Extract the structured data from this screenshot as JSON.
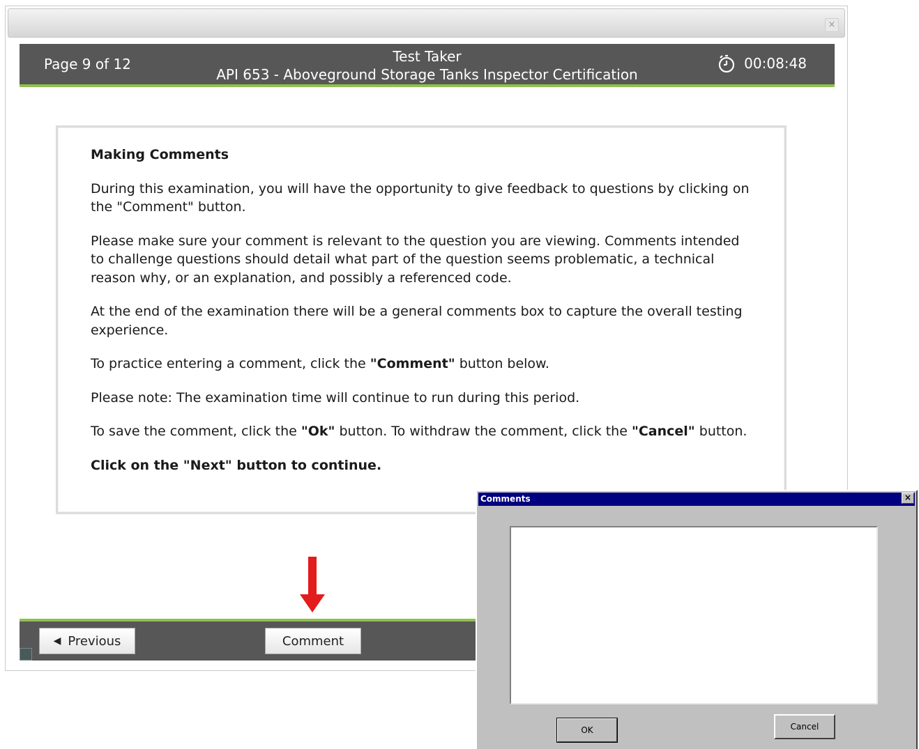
{
  "window": {
    "close_label": "×"
  },
  "header": {
    "page_indicator": "Page 9 of 12",
    "test_taker": "Test Taker",
    "exam_title": "API 653 - Aboveground Storage Tanks Inspector Certification",
    "timer": "00:08:48",
    "timer_icon": "stopwatch-icon",
    "accent_color": "#8fc050",
    "bar_color": "#575757"
  },
  "content": {
    "heading": "Making Comments",
    "p1": "During this examination, you will have the opportunity to give feedback to questions by clicking on the \"Comment\" button.",
    "p2": "Please make sure your comment is relevant to the question you are viewing. Comments intended to challenge questions should detail what part of the question seems problematic, a technical reason why, or an explanation, and possibly a referenced code.",
    "p3": "At the end of the examination there will be a general comments box to capture the overall testing experience.",
    "p4_before": "To practice entering a comment, click the ",
    "p4_bold": "\"Comment\"",
    "p4_after": " button below.",
    "p5": "Please note: The examination time will continue to run during this period.",
    "p6_a": "To save the comment, click the ",
    "p6_b": "\"Ok\"",
    "p6_c": " button. To withdraw the comment, click the ",
    "p6_d": "\"Cancel\"",
    "p6_e": " button.",
    "p7": "Click on the \"Next\" button to continue."
  },
  "footer": {
    "previous_label": "Previous",
    "previous_icon": "triangle-left-icon",
    "comment_label": "Comment"
  },
  "dialog": {
    "title": "Comments",
    "close_label": "×",
    "comment_value": "",
    "ok_label": "OK",
    "cancel_label": "Cancel"
  }
}
